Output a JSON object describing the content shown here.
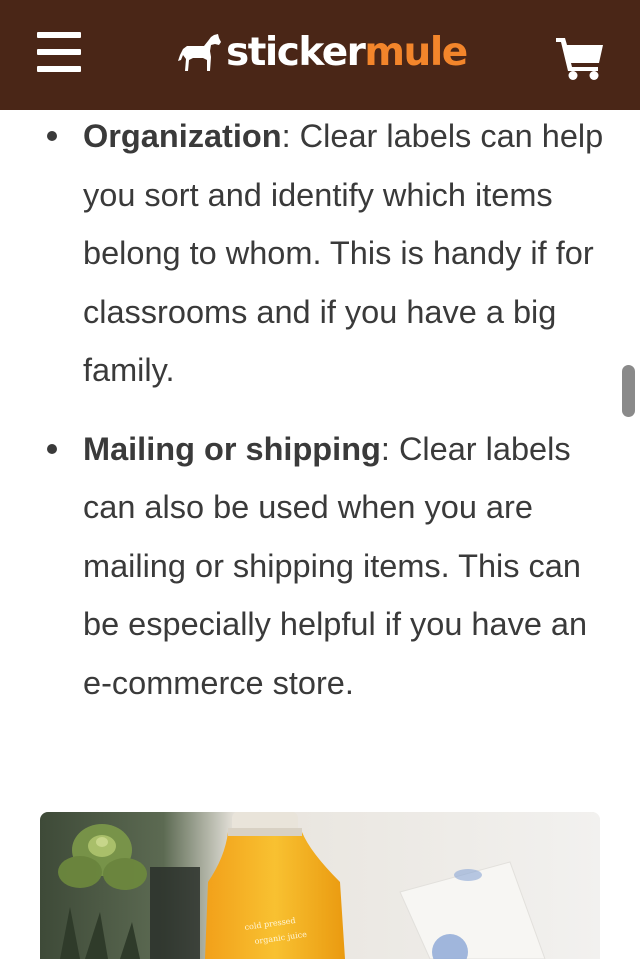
{
  "header": {
    "brand_primary": "sticker",
    "brand_accent": "mule",
    "colors": {
      "background": "#4a2617",
      "brand_accent": "#f3852b",
      "icon": "#ffffff"
    },
    "icons": [
      "menu-icon",
      "mule-logo-icon",
      "cart-icon"
    ]
  },
  "article": {
    "bullets": [
      {
        "term": "Organization",
        "text": ": Clear labels can help you sort and identify which items belong to whom. This is handy if for classrooms and if you have a big family."
      },
      {
        "term": "Mailing or shipping",
        "text": ": Clear labels can also be used when you are mailing or shipping items. This can be especially helpful if you have an e-commerce store."
      }
    ]
  },
  "image": {
    "bottle_label": "cold pressed organic juice"
  }
}
